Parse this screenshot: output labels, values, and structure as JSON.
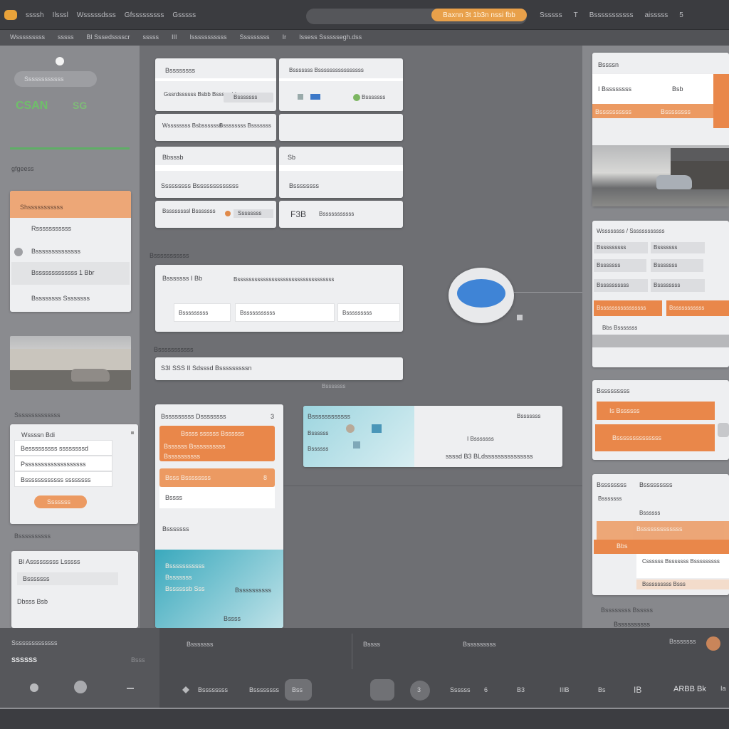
{
  "topbar": {
    "menu": [
      "ssssh",
      "Ilsssl",
      "Wsssssdsss",
      "Gfsssssssss",
      "Gsssss"
    ],
    "search_badge": "Baxnn 3t    1b3n nssi  fbb",
    "right_items": [
      "Ssssss",
      "T",
      "Bsssssssssss",
      "aisssss",
      "5"
    ]
  },
  "subbar": {
    "crumbs": [
      "Wsssssssss",
      "sssss",
      "Bl Sssedsssscr",
      "sssss",
      "III",
      "Isssssssssss",
      "Sssssssss",
      "Ir"
    ],
    "path": "Issess Ssssssegh.dss"
  },
  "left": {
    "search_placeholder": "Ssssssssssss",
    "brand": "CSAN",
    "brand_badge": "SG",
    "section_label": "gfgeess",
    "list_items": [
      "Shsssssssssss",
      "Rsssssssssss",
      "Bssssssssssssss",
      "Bsssssssssssss 1 Bbr",
      "Bssssssss Ssssssss"
    ],
    "caption": "Ssssssssssssss",
    "form": {
      "title": "Wssssn Bdi",
      "row1": "Besssssssss ssssssssd",
      "row2": "Psssssssssssssssssss",
      "row3": "Bssssssssssss ssssssss",
      "button": "Sssssss"
    },
    "caption2": "Bssssssssss",
    "note": {
      "title": "Bl  Asssssssss Lsssss",
      "row1": "Bsssssss",
      "row2": "Dbsss  Bsb"
    }
  },
  "center": {
    "grid": [
      {
        "title": "Bssssssss",
        "sub": "Gssrdssssss\nBsbb Bssssy bls",
        "chip": "Bsssssss"
      },
      {
        "title": "Bsssssss Bssssssssssssssss",
        "sub": "",
        "chip": "Bsssssss"
      },
      {
        "title": "Wssssssss\nBsbsssssss",
        "sub": "Bssssssss\nBsssssss",
        "chip": ""
      },
      {
        "title": "",
        "sub": "",
        "chip": ""
      },
      {
        "title": "Bbsssb",
        "sub": "Sssssssss  Bsssssssssssss",
        "chip": ""
      },
      {
        "title": "Sb",
        "sub": "Bssssssss",
        "chip": ""
      },
      {
        "title": "Bssssssssl\nBsssssss",
        "sub": "Ssssssss",
        "chip": ""
      },
      {
        "title": "F3B",
        "sub": "Bsssssssssss",
        "chip": ""
      }
    ],
    "section_label": "Bsssssssssss",
    "wide_card": {
      "title": "Bsssssss  I  Bb",
      "subtitle": "Bssssssssssssssssssssssssssssssssss",
      "fields": [
        "Bsssssssss",
        "Bsssssssssss",
        "Bsssssssss"
      ]
    },
    "section_label2": "Bsssssssssss",
    "input_value": "S3I SSS II Sdsssd  Bsssssssssn",
    "tag": "Bsssssss",
    "panel": {
      "title": "Bsssssssss  Dssssssss",
      "count": "3",
      "row1": "Bssss ssssss Bssssss",
      "row1b": "Bssssss Bssssssssss",
      "row1c": "Bssssssssss",
      "row2": "Bsss Bssssssss",
      "row2_count": "8",
      "row3": "Bssss",
      "row4": "Bsssssss",
      "teal1": "Bsssssssssss",
      "teal2": "Bsssssss",
      "teal3": "Bssssssb Sss",
      "teal4": "Bssssssssss",
      "teal5": "Bssss"
    },
    "detail": {
      "title": "Bssssssssssss",
      "rows": [
        "Bssssss",
        "Bssssss",
        "Bssssssss"
      ],
      "side": "Bsssssss",
      "mid": "I  Bsssssss",
      "caption": "ssssd  B3 BLdsssssssssssssss"
    }
  },
  "right": {
    "header": "Bssssn",
    "selected_row": "I Bssssssss",
    "selected_value": "Bsb",
    "orange_row": [
      "Bssssssssss",
      "Bssssssss"
    ],
    "section": "Wssssssss / Ssssssssssss",
    "table": [
      [
        "Bsssssssss",
        "Bsssssss"
      ],
      [
        "Bsssssss",
        "Bsssssss"
      ],
      [
        "Bssssssssss",
        "Bssssssss"
      ],
      [
        "Bssssssssssssssss",
        "Bsssssssssss"
      ],
      [
        "Bbs  Bsssssss",
        ""
      ]
    ],
    "section2": "Bsssssssss",
    "orange_btn1": "Is  Bssssss",
    "orange_btn2": "Bssssssssssssss",
    "list_header": [
      "Bssssssss",
      "Bsssssssss"
    ],
    "list_rows": [
      "Bsssssss",
      "Bssssss",
      "Bsssssssssssss",
      "Bbs",
      "Cssssss Bsssssss Bsssssssss",
      "Bsssssssss Bsss"
    ],
    "footer1": "Bssssssss Bsssss",
    "footer2": "Bssssssssss"
  },
  "bottom": {
    "left_label": "Ssssssssssssss",
    "left_title": "SSSSSS",
    "left_aux": "Bsss",
    "mid_labels": [
      "Bsssssss",
      "Bssss",
      "Bsssssssss"
    ],
    "right_label": "Bsssssss",
    "nav": [
      "Bssssssss",
      "Bssssssss",
      "Bss",
      "",
      "3",
      "Ssssss",
      "6",
      "B3",
      "IIIB",
      "Bs",
      "IB",
      "ARBB  Bk",
      "Ia"
    ]
  }
}
